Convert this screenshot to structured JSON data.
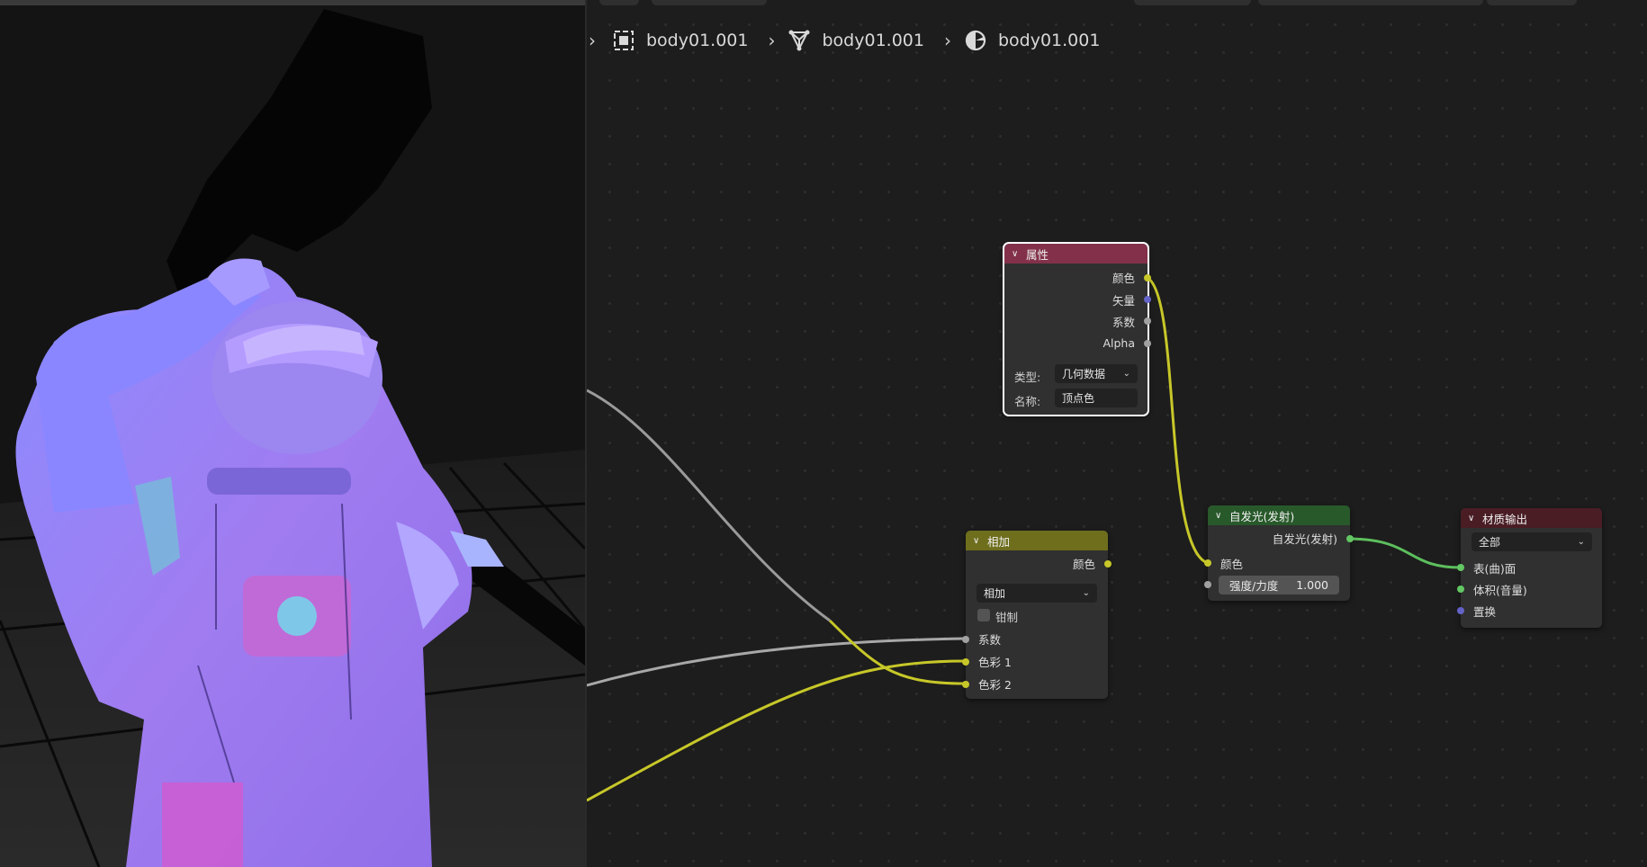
{
  "breadcrumb": {
    "items": [
      {
        "label": "body01.001",
        "icon": "object-icon"
      },
      {
        "label": "body01.001",
        "icon": "mesh-data-icon"
      },
      {
        "label": "body01.001",
        "icon": "material-icon"
      }
    ]
  },
  "nodes": {
    "attribute": {
      "title": "属性",
      "outputs": [
        "颜色",
        "矢量",
        "系数",
        "Alpha"
      ],
      "type_label": "类型:",
      "type_value": "几何数据",
      "name_label": "名称:",
      "name_value": "顶点色",
      "header_color": "#83314a"
    },
    "mix": {
      "title": "相加",
      "output": "颜色",
      "blend_value": "相加",
      "clamp_label": "钳制",
      "inputs": [
        "系数",
        "色彩 1",
        "色彩 2"
      ],
      "header_color": "#6e6e1d"
    },
    "emission": {
      "title": "自发光(发射)",
      "output": "自发光(发射)",
      "input_color": "颜色",
      "strength_label": "强度/力度",
      "strength_value": "1.000",
      "header_color": "#28592a"
    },
    "output": {
      "title": "材质输出",
      "target_value": "全部",
      "inputs": [
        "表(曲)面",
        "体积(音量)",
        "置换"
      ],
      "header_color": "#4a1d25"
    }
  },
  "colors": {
    "editor_bg": "#1d1d1d",
    "wire_yellow": "#c7c729",
    "wire_gray": "#9a9a9a",
    "wire_green": "#5dbf5d"
  }
}
